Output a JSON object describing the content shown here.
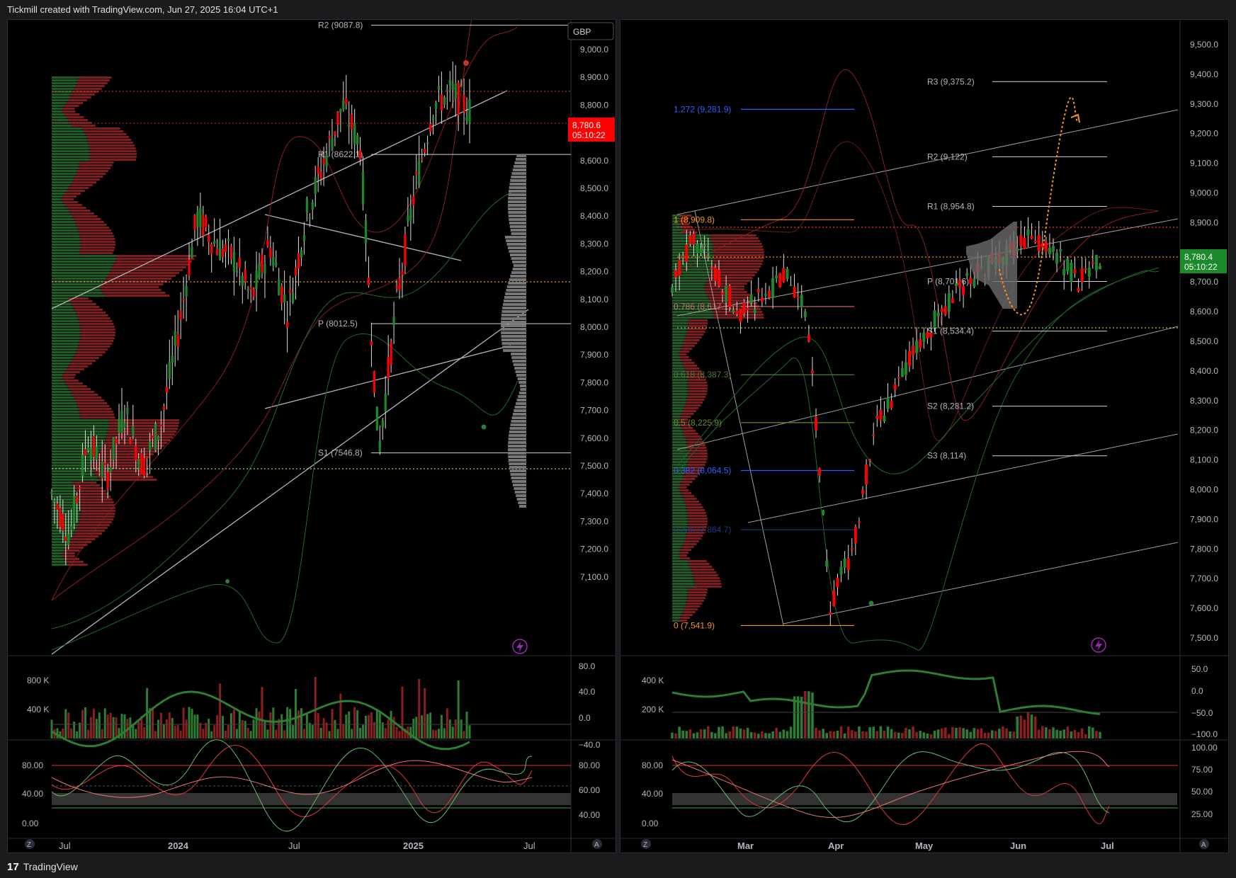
{
  "header": {
    "caption": "Tickmill created with TradingView.com, Jun 27, 2025 16:04 UTC+1"
  },
  "footer": {
    "brand": "TradingView",
    "logo_glyph": "17"
  },
  "colors": {
    "up": "#1b8a2a",
    "down": "#f00",
    "bg": "#000",
    "grid_text": "#b2b5be"
  },
  "left": {
    "currency_badge": "GBP",
    "price_tag": {
      "price": "8,780.6",
      "timer": "05:10:22"
    },
    "price_axis": [
      "9,000.0",
      "8,900.0",
      "8,800.0",
      "8,700.0",
      "8,600.0",
      "8,500.0",
      "8,400.0",
      "8,300.0",
      "8,200.0",
      "8,100.0",
      "8,000.0",
      "7,900.0",
      "7,800.0",
      "7,700.0",
      "7,600.0",
      "7,500.0",
      "7,400.0",
      "7,300.0",
      "7,200.0",
      "7,100.0"
    ],
    "pivots": [
      {
        "label": "R2 (9087.8)",
        "value": 9087.8
      },
      {
        "label": "R1 (8622.1)",
        "value": 8622.1
      },
      {
        "label": "P (8012.5)",
        "value": 8012.5
      },
      {
        "label": "S1 (7546.8)",
        "value": 7546.8
      }
    ],
    "time_axis": [
      "Jul",
      "2024",
      "Jul",
      "2025",
      "Jul"
    ],
    "volume_axis": [
      "800 K",
      "400 K"
    ],
    "osc_axis": [
      "80.0",
      "40.0",
      "0.0",
      "−40.0"
    ],
    "stoch_axis_left": [
      "80.00",
      "40.00",
      "0.00"
    ],
    "stoch_axis_right": [
      "80.00",
      "60.00",
      "40.00"
    ],
    "corner_z": "Z",
    "corner_a": "A"
  },
  "right": {
    "price_tag": {
      "price": "8,780.4",
      "timer": "05:10:22"
    },
    "price_axis": [
      "9,500.0",
      "9,400.0",
      "9,300.0",
      "9,200.0",
      "9,100.0",
      "9,000.0",
      "8,900.0",
      "8,800.0",
      "8,700.0",
      "8,600.0",
      "8,500.0",
      "8,400.0",
      "8,300.0",
      "8,200.0",
      "8,100.0",
      "8,000.0",
      "7,900.0",
      "7,800.0",
      "7,700.0",
      "7,600.0",
      "7,500.0"
    ],
    "pivots": [
      {
        "label": "R3 (9,375.2)",
        "value": 9375.2
      },
      {
        "label": "R2 (9,122)",
        "value": 9122
      },
      {
        "label": "R1 (8,954.8)",
        "value": 8954.8
      },
      {
        "label": "P (8,701.6)",
        "value": 8701.6
      },
      {
        "label": "S1 (8,534.4)",
        "value": 8534.4
      },
      {
        "label": "S2 (8,281.2)",
        "value": 8281.2
      },
      {
        "label": "S3 (8,114)",
        "value": 8114
      }
    ],
    "fibs": [
      {
        "label": "1.272 (9,281.9)",
        "value": 9281.9,
        "color": "#2962ff"
      },
      {
        "label": "1 (8,909.8)",
        "value": 8909.8,
        "color": "#f7931a"
      },
      {
        "label": "0.786 (8,617.1)",
        "value": 8617.1,
        "color": "#d36f6f"
      },
      {
        "label": "0.618 (8,387.3)",
        "value": 8387.3,
        "color": "#4c7a3a"
      },
      {
        "label": "0.5 (8,225.9)",
        "value": 8225.9,
        "color": "#6a8a2a"
      },
      {
        "label": "0.382 (8,064.5)",
        "value": 8064.5,
        "color": "#2962ff"
      },
      {
        "label": "0.236 (7,864.7)",
        "value": 7864.7,
        "color": "#1f3a8a"
      },
      {
        "label": "0 (7,541.9)",
        "value": 7541.9,
        "color": "#f7931a"
      }
    ],
    "time_axis": [
      "Mar",
      "Apr",
      "May",
      "Jun",
      "Jul"
    ],
    "volume_axis": [
      "400 K",
      "200 K"
    ],
    "osc_axis": [
      "50.0",
      "0.0",
      "−50.0",
      "−100.0"
    ],
    "stoch_axis_left": [
      "80.00",
      "40.00",
      "0.00"
    ],
    "stoch_axis_right": [
      "100.00",
      "75.00",
      "50.00",
      "25.00"
    ],
    "corner_z": "Z",
    "corner_a": "A"
  },
  "chart_data": [
    {
      "type": "candlestick",
      "title": "",
      "ylim": [
        7050,
        9150
      ],
      "x": [
        "Jul 2023",
        "2024",
        "Jul 2024",
        "2025",
        "Jul 2025"
      ],
      "series": [
        {
          "name": "",
          "values": [
            7400,
            7250,
            7600,
            7450,
            7700,
            7500,
            7650,
            8000,
            8400,
            8300,
            8250,
            8100,
            8300,
            8050,
            8400,
            8600,
            8800,
            8650,
            7550,
            8100,
            8500,
            8800,
            8850,
            8780
          ]
        }
      ],
      "levels": [
        9087.8,
        8622.1,
        8012.5,
        7546.8
      ]
    },
    {
      "type": "candlestick",
      "title": "",
      "ylim": [
        7450,
        9550
      ],
      "x": [
        "Mar",
        "Apr",
        "May",
        "Jun",
        "Jul"
      ],
      "series": [
        {
          "name": "",
          "values": [
            8700,
            8850,
            8720,
            8600,
            8650,
            8720,
            8600,
            7600,
            7800,
            8200,
            8350,
            8500,
            8600,
            8700,
            8750,
            8800,
            8850,
            8800,
            8700,
            8780
          ]
        }
      ],
      "levels": [
        9375.2,
        9122,
        8954.8,
        8701.6,
        8534.4,
        8281.2,
        8114
      ]
    }
  ]
}
